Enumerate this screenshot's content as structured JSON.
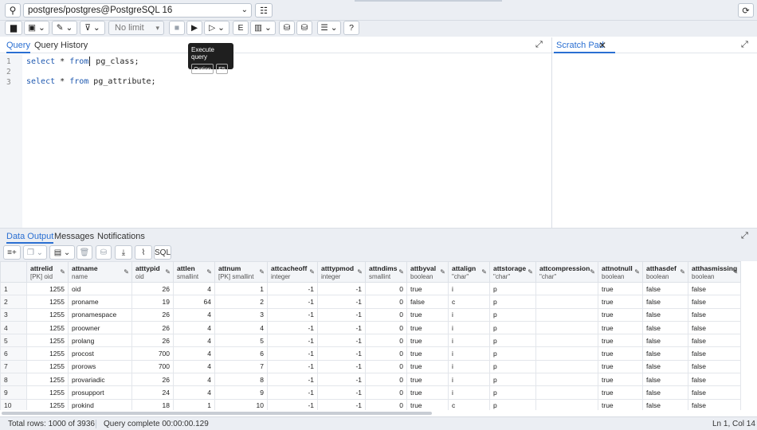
{
  "connection": {
    "label": "postgres/postgres@PostgreSQL 16"
  },
  "toolbar": {
    "limit_label": "No limit"
  },
  "tooltip": {
    "title": "Execute query",
    "key1": "Option",
    "key2": "F5"
  },
  "query_tabs": {
    "query": "Query",
    "history": "Query History"
  },
  "scratch": {
    "tab": "Scratch Pad"
  },
  "editor": {
    "line_numbers": [
      "1",
      "2",
      "3"
    ],
    "line1_kw1": "select",
    "line1_mid": " * ",
    "line1_kw2": "from",
    "line1_rest": " pg_class;",
    "line3_kw1": "select",
    "line3_mid": " * ",
    "line3_kw2": "from",
    "line3_rest": " pg_attribute;"
  },
  "output_tabs": {
    "data": "Data Output",
    "messages": "Messages",
    "notifications": "Notifications"
  },
  "output_toolbar": {
    "sql_label": "SQL"
  },
  "grid": {
    "columns": [
      {
        "name": "attrelid",
        "type": "[PK] oid"
      },
      {
        "name": "attname",
        "type": "name"
      },
      {
        "name": "atttypid",
        "type": "oid"
      },
      {
        "name": "attlen",
        "type": "smallint"
      },
      {
        "name": "attnum",
        "type": "[PK] smallint"
      },
      {
        "name": "attcacheoff",
        "type": "integer"
      },
      {
        "name": "atttypmod",
        "type": "integer"
      },
      {
        "name": "attndims",
        "type": "smallint"
      },
      {
        "name": "attbyval",
        "type": "boolean"
      },
      {
        "name": "attalign",
        "type": "\"char\""
      },
      {
        "name": "attstorage",
        "type": "\"char\""
      },
      {
        "name": "attcompression",
        "type": "\"char\""
      },
      {
        "name": "attnotnull",
        "type": "boolean"
      },
      {
        "name": "atthasdef",
        "type": "boolean"
      },
      {
        "name": "atthasmissing",
        "type": "boolean"
      }
    ],
    "rows": [
      [
        "1",
        "1255",
        "oid",
        "26",
        "4",
        "1",
        "-1",
        "-1",
        "0",
        "true",
        "i",
        "p",
        "",
        "true",
        "false",
        "false"
      ],
      [
        "2",
        "1255",
        "proname",
        "19",
        "64",
        "2",
        "-1",
        "-1",
        "0",
        "false",
        "c",
        "p",
        "",
        "true",
        "false",
        "false"
      ],
      [
        "3",
        "1255",
        "pronamespace",
        "26",
        "4",
        "3",
        "-1",
        "-1",
        "0",
        "true",
        "i",
        "p",
        "",
        "true",
        "false",
        "false"
      ],
      [
        "4",
        "1255",
        "proowner",
        "26",
        "4",
        "4",
        "-1",
        "-1",
        "0",
        "true",
        "i",
        "p",
        "",
        "true",
        "false",
        "false"
      ],
      [
        "5",
        "1255",
        "prolang",
        "26",
        "4",
        "5",
        "-1",
        "-1",
        "0",
        "true",
        "i",
        "p",
        "",
        "true",
        "false",
        "false"
      ],
      [
        "6",
        "1255",
        "procost",
        "700",
        "4",
        "6",
        "-1",
        "-1",
        "0",
        "true",
        "i",
        "p",
        "",
        "true",
        "false",
        "false"
      ],
      [
        "7",
        "1255",
        "prorows",
        "700",
        "4",
        "7",
        "-1",
        "-1",
        "0",
        "true",
        "i",
        "p",
        "",
        "true",
        "false",
        "false"
      ],
      [
        "8",
        "1255",
        "provariadic",
        "26",
        "4",
        "8",
        "-1",
        "-1",
        "0",
        "true",
        "i",
        "p",
        "",
        "true",
        "false",
        "false"
      ],
      [
        "9",
        "1255",
        "prosupport",
        "24",
        "4",
        "9",
        "-1",
        "-1",
        "0",
        "true",
        "i",
        "p",
        "",
        "true",
        "false",
        "false"
      ],
      [
        "10",
        "1255",
        "prokind",
        "18",
        "1",
        "10",
        "-1",
        "-1",
        "0",
        "true",
        "c",
        "p",
        "",
        "true",
        "false",
        "false"
      ]
    ]
  },
  "status": {
    "total_rows": "Total rows: 1000 of 3936",
    "query_complete": "Query complete 00:00:00.129",
    "position": "Ln 1, Col 14"
  }
}
